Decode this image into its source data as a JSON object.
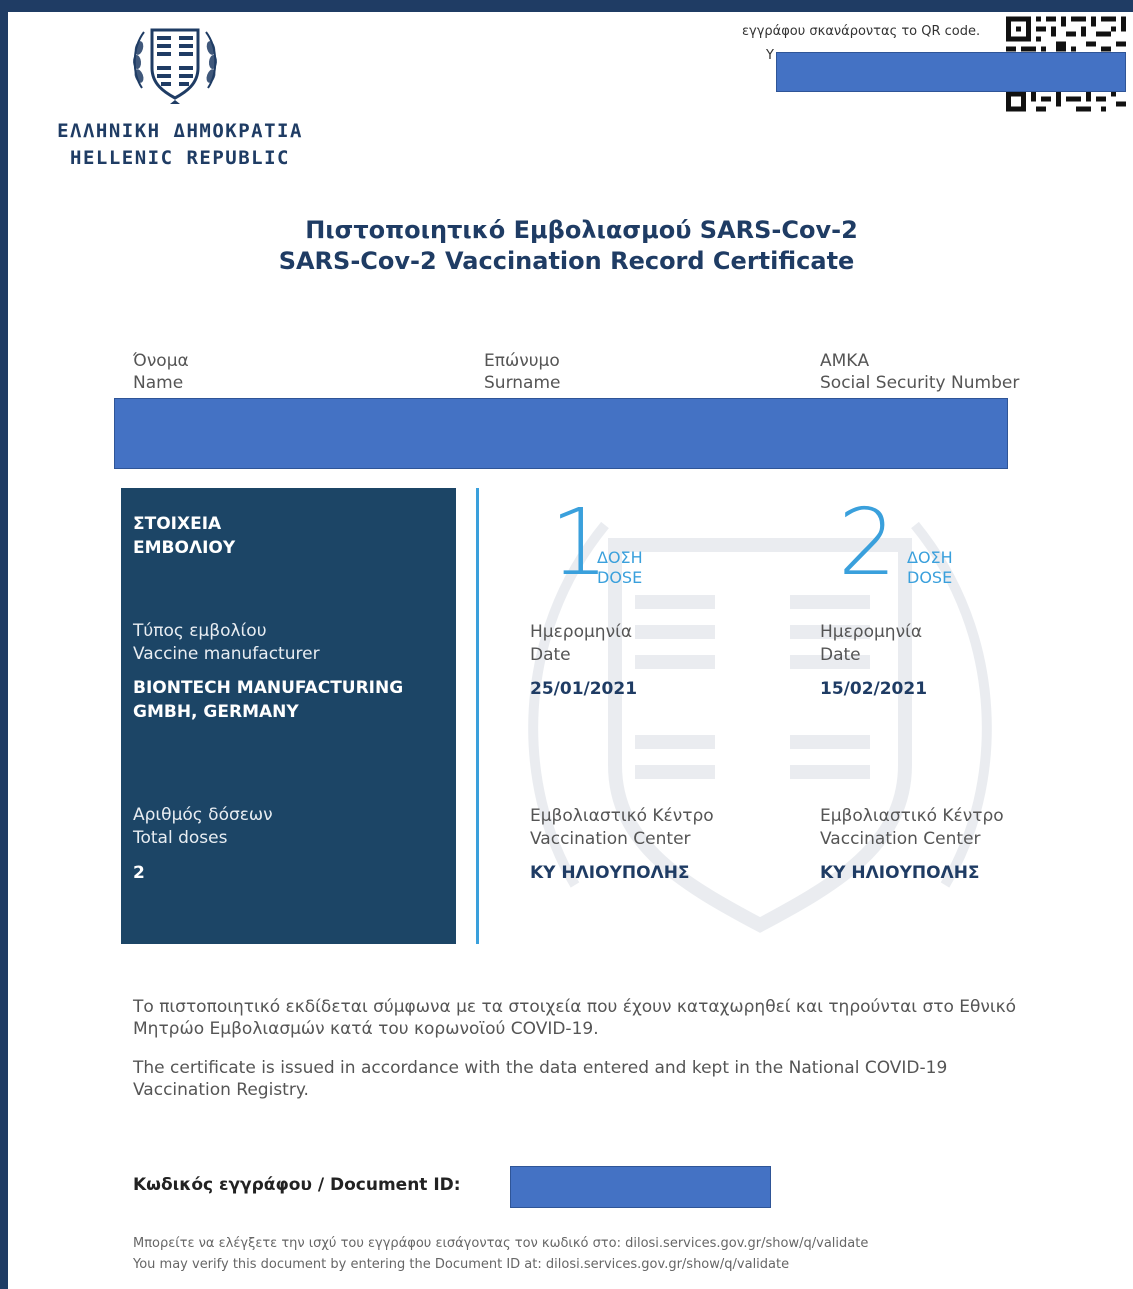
{
  "header": {
    "republic_gr": "ΕΛΛΗΝΙΚΗ ΔΗΜΟΚΡΑΤΙΑ",
    "republic_en": "HELLENIC REPUBLIC",
    "qr_note": "εγγράφου σκανάροντας το QR code.",
    "qr_note_partial": "Y"
  },
  "title": {
    "greek": "Πιστοποιητικό Εμβολιασμού SARS-Cov-2",
    "english": "SARS-Cov-2 Vaccination Record Certificate"
  },
  "person_fields": {
    "name_gr": "Όνομα",
    "name_en": "Name",
    "surname_gr": "Επώνυμο",
    "surname_en": "Surname",
    "amka_gr": "ΑΜΚΑ",
    "amka_en": "Social Security Number"
  },
  "panel": {
    "heading_line1": "ΣΤΟΙΧΕΙΑ",
    "heading_line2": "ΕΜΒΟΛΙΟΥ",
    "type_gr": "Τύπος εμβολίου",
    "type_en": "Vaccine manufacturer",
    "manufacturer_line1": "BIONTECH MANUFACTURING",
    "manufacturer_line2": "GMBH, GERMANY",
    "doses_gr": "Αριθμός δόσεων",
    "doses_en": "Total doses",
    "doses_value": "2"
  },
  "doses": [
    {
      "number": "1",
      "label_gr": "ΔΟΣΗ",
      "label_en": "DOSE",
      "date_gr": "Ημερομηνία",
      "date_en": "Date",
      "date": "25/01/2021",
      "center_gr": "Εμβολιαστικό Κέντρο",
      "center_en": "Vaccination Center",
      "center": "ΚΥ ΗΛΙΟΥΠΟΛΗΣ"
    },
    {
      "number": "2",
      "label_gr": "ΔΟΣΗ",
      "label_en": "DOSE",
      "date_gr": "Ημερομηνία",
      "date_en": "Date",
      "date": "15/02/2021",
      "center_gr": "Εμβολιαστικό Κέντρο",
      "center_en": "Vaccination Center",
      "center": "ΚΥ ΗΛΙΟΥΠΟΛΗΣ"
    }
  ],
  "notes": {
    "greek_line1": "Το πιστοποιητικό εκδίδεται σύμφωνα με τα στοιχεία που έχουν καταχωρηθεί και τηρούνται στο Εθνικό",
    "greek_line2": "Μητρώο Εμβολιασμών κατά του κορωνοϊού COVID-19.",
    "english_line1": "The certificate is issued in accordance with the data entered and kept in the National COVID-19",
    "english_line2": "Vaccination Registry."
  },
  "document": {
    "id_label": "Κωδικός εγγράφου / Document ID:",
    "verify_gr": "Μπορείτε να ελέγξετε την ισχύ του εγγράφου εισάγοντας τον κωδικό στο: dilosi.services.gov.gr/show/q/validate",
    "verify_en": "You may verify this document by entering the Document ID at: dilosi.services.gov.gr/show/q/validate"
  },
  "colors": {
    "navy": "#1f3c64",
    "panel": "#1c4566",
    "accent": "#3aa0dc",
    "redaction": "#4472c4"
  }
}
